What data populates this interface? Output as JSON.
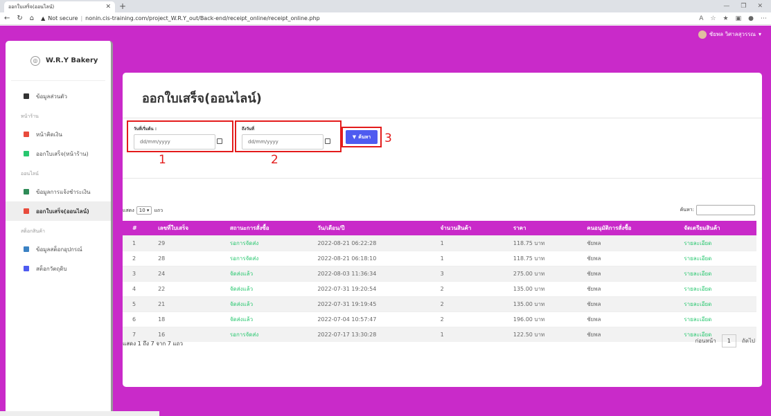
{
  "browser": {
    "tab_title": "ออกใบเสร็จ(ออนไลน์)",
    "url_security": "Not secure",
    "url": "nonin.cis-training.com/project_W.R.Y_out/Back-end/receipt_online/receipt_online.php"
  },
  "brand": "W.R.Y Bakery",
  "user": "ชัยพล วิศาลสุวรรณ",
  "sidebar": {
    "profile": "ข้อมูลส่วนตัว",
    "sec_front": "หน้าร้าน",
    "cashier": "หน้าคิดเงิน",
    "receipt_front": "ออกใบเสร็จ(หน้าร้าน)",
    "sec_online": "ออนไลน์",
    "payment": "ข้อมูลการแจ้งชำระเงิน",
    "receipt_online": "ออกใบเสร็จ(ออนไลน์)",
    "sec_stock": "สต็อกสินค้า",
    "stock_equipment": "ข้อมูลสต็อกอุปกรณ์",
    "stock_material": "สต็อกวัตถุดิบ"
  },
  "page": {
    "title": "ออกใบเสร็จ(ออนไลน์)",
    "start_label": "วันที่เริ่มต้น :",
    "end_label": "ถึงวันที่",
    "date_placeholder": "dd/mm/yyyy",
    "search_btn": "ค้นหา",
    "ann1": "1",
    "ann2": "2",
    "ann3": "3",
    "show_label": "แสดง",
    "show_value": "10",
    "rows_label": "แถว",
    "search_label": "ค้นหา:",
    "info": "แสดง 1 ถึง 7 จาก 7 แถว",
    "prev": "ก่อนหน้า",
    "page_num": "1",
    "next": "ถัดไป"
  },
  "table": {
    "headers": [
      "#",
      "เลขที่ใบเสร็จ",
      "สถานะการสั่งซื้อ",
      "วัน/เดือน/ปี",
      "จำนวนสินค้า",
      "ราคา",
      "คนอนุมัติการสั่งซื้อ",
      "จัดเตรียมสินค้า"
    ],
    "rows": [
      [
        "1",
        "29",
        "รอการจัดส่ง",
        "2022-08-21 06:22:28",
        "1",
        "118.75 บาท",
        "ชัยพล",
        "รายละเอียด"
      ],
      [
        "2",
        "28",
        "รอการจัดส่ง",
        "2022-08-21 06:18:10",
        "1",
        "118.75 บาท",
        "ชัยพล",
        "รายละเอียด"
      ],
      [
        "3",
        "24",
        "จัดส่งแล้ว",
        "2022-08-03 11:36:34",
        "3",
        "275.00 บาท",
        "ชัยพล",
        "รายละเอียด"
      ],
      [
        "4",
        "22",
        "จัดส่งแล้ว",
        "2022-07-31 19:20:54",
        "2",
        "135.00 บาท",
        "ชัยพล",
        "รายละเอียด"
      ],
      [
        "5",
        "21",
        "จัดส่งแล้ว",
        "2022-07-31 19:19:45",
        "2",
        "135.00 บาท",
        "ชัยพล",
        "รายละเอียด"
      ],
      [
        "6",
        "18",
        "จัดส่งแล้ว",
        "2022-07-04 10:57:47",
        "2",
        "196.00 บาท",
        "ชัยพล",
        "รายละเอียด"
      ],
      [
        "7",
        "16",
        "รอการจัดส่ง",
        "2022-07-17 13:30:28",
        "1",
        "122.50 บาท",
        "ชัยพล",
        "รายละเอียด"
      ]
    ]
  },
  "colors": {
    "accent": "#c92ac9",
    "button": "#4e5bf0",
    "status": "#28c76f",
    "annotation": "#e31b1b"
  }
}
